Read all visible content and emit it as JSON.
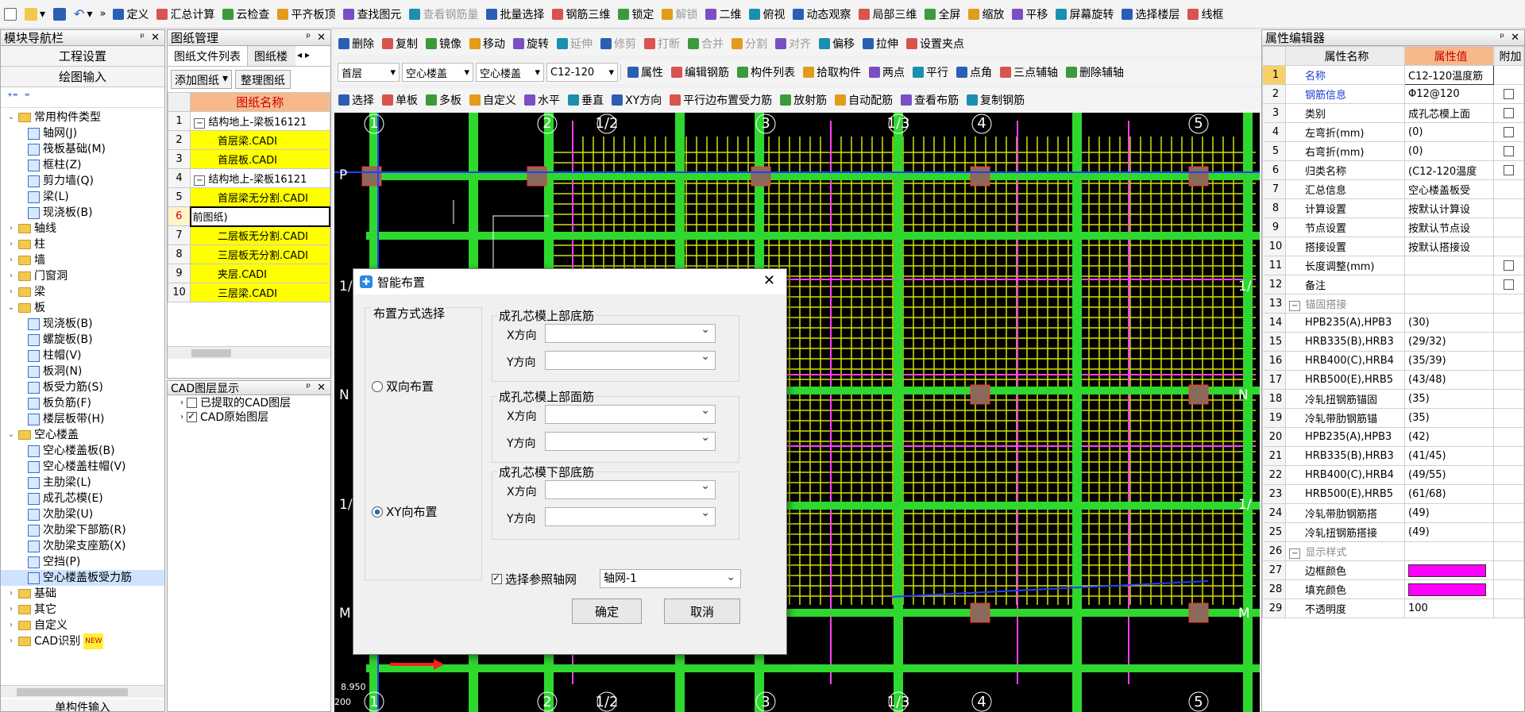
{
  "toolbar1": {
    "items": [
      "定义",
      "汇总计算",
      "云检查",
      "平齐板顶",
      "查找图元",
      "查看钢筋量",
      "批量选择",
      "钢筋三维",
      "锁定",
      "解锁",
      "二维",
      "俯视",
      "动态观察",
      "局部三维",
      "全屏",
      "缩放",
      "平移",
      "屏幕旋转",
      "选择楼层",
      "线框"
    ]
  },
  "toolbar2": {
    "items": [
      "删除",
      "复制",
      "镜像",
      "移动",
      "旋转",
      "延伸",
      "修剪",
      "打断",
      "合并",
      "分割",
      "对齐",
      "偏移",
      "拉伸",
      "设置夹点"
    ]
  },
  "toolbar3": {
    "floor": "首层",
    "cat": "空心楼盖",
    "sub": "空心楼盖",
    "comp": "C12-120",
    "items": [
      "属性",
      "编辑钢筋",
      "构件列表",
      "拾取构件",
      "两点",
      "平行",
      "点角",
      "三点辅轴",
      "删除辅轴"
    ]
  },
  "toolbar4": {
    "items": [
      "选择",
      "单板",
      "多板",
      "自定义",
      "水平",
      "垂直",
      "XY方向",
      "平行边布置受力筋",
      "放射筋",
      "自动配筋",
      "查看布筋",
      "复制钢筋"
    ]
  },
  "nav": {
    "title": "模块导航栏",
    "btn1": "工程设置",
    "btn2": "绘图输入",
    "bottom": "单构件输入",
    "tree": [
      {
        "lvl": 0,
        "exp": "⌄",
        "kind": "folder",
        "label": "常用构件类型"
      },
      {
        "lvl": 1,
        "kind": "comp",
        "label": "轴网(J)"
      },
      {
        "lvl": 1,
        "kind": "comp",
        "label": "筏板基础(M)"
      },
      {
        "lvl": 1,
        "kind": "comp",
        "label": "框柱(Z)"
      },
      {
        "lvl": 1,
        "kind": "comp",
        "label": "剪力墙(Q)"
      },
      {
        "lvl": 1,
        "kind": "comp",
        "label": "梁(L)"
      },
      {
        "lvl": 1,
        "kind": "comp",
        "label": "现浇板(B)"
      },
      {
        "lvl": 0,
        "exp": "›",
        "kind": "folder",
        "label": "轴线"
      },
      {
        "lvl": 0,
        "exp": "›",
        "kind": "folder",
        "label": "柱"
      },
      {
        "lvl": 0,
        "exp": "›",
        "kind": "folder",
        "label": "墙"
      },
      {
        "lvl": 0,
        "exp": "›",
        "kind": "folder",
        "label": "门窗洞"
      },
      {
        "lvl": 0,
        "exp": "›",
        "kind": "folder",
        "label": "梁"
      },
      {
        "lvl": 0,
        "exp": "⌄",
        "kind": "folder",
        "label": "板"
      },
      {
        "lvl": 1,
        "kind": "comp",
        "label": "现浇板(B)"
      },
      {
        "lvl": 1,
        "kind": "comp",
        "label": "螺旋板(B)"
      },
      {
        "lvl": 1,
        "kind": "comp",
        "label": "柱帽(V)"
      },
      {
        "lvl": 1,
        "kind": "comp",
        "label": "板洞(N)"
      },
      {
        "lvl": 1,
        "kind": "comp",
        "label": "板受力筋(S)"
      },
      {
        "lvl": 1,
        "kind": "comp",
        "label": "板负筋(F)"
      },
      {
        "lvl": 1,
        "kind": "comp",
        "label": "楼层板带(H)"
      },
      {
        "lvl": 0,
        "exp": "⌄",
        "kind": "folder",
        "label": "空心楼盖"
      },
      {
        "lvl": 1,
        "kind": "comp",
        "label": "空心楼盖板(B)"
      },
      {
        "lvl": 1,
        "kind": "comp",
        "label": "空心楼盖柱帽(V)"
      },
      {
        "lvl": 1,
        "kind": "comp",
        "label": "主肋梁(L)"
      },
      {
        "lvl": 1,
        "kind": "comp",
        "label": "成孔芯模(E)"
      },
      {
        "lvl": 1,
        "kind": "comp",
        "label": "次肋梁(U)"
      },
      {
        "lvl": 1,
        "kind": "comp",
        "label": "次肋梁下部筋(R)"
      },
      {
        "lvl": 1,
        "kind": "comp",
        "label": "次肋梁支座筋(X)"
      },
      {
        "lvl": 1,
        "kind": "comp",
        "label": "空挡(P)"
      },
      {
        "lvl": 1,
        "kind": "comp",
        "label": "空心楼盖板受力筋",
        "sel": true
      },
      {
        "lvl": 0,
        "exp": "›",
        "kind": "folder",
        "label": "基础"
      },
      {
        "lvl": 0,
        "exp": "›",
        "kind": "folder",
        "label": "其它"
      },
      {
        "lvl": 0,
        "exp": "›",
        "kind": "folder",
        "label": "自定义"
      },
      {
        "lvl": 0,
        "exp": "›",
        "kind": "folder",
        "label": "CAD识别",
        "badge": "NEW"
      }
    ]
  },
  "drawings": {
    "title": "图纸管理",
    "tab1": "图纸文件列表",
    "tab2": "图纸楼层",
    "add": "添加图纸",
    "tidy": "整理图纸",
    "col": "图纸名称",
    "rows": [
      {
        "n": "1",
        "name": "结构地上-梁板16121",
        "grp": true
      },
      {
        "n": "2",
        "name": "首层梁.CADI",
        "y": true
      },
      {
        "n": "3",
        "name": "首层板.CADI",
        "y": true
      },
      {
        "n": "4",
        "name": "结构地上-梁板16121",
        "grp": true
      },
      {
        "n": "5",
        "name": "首层梁无分割.CADI",
        "y": true
      },
      {
        "n": "6",
        "name": "前图纸)",
        "cur": true
      },
      {
        "n": "7",
        "name": "二层板无分割.CADI",
        "y": true
      },
      {
        "n": "8",
        "name": "三层板无分割.CADI",
        "y": true
      },
      {
        "n": "9",
        "name": "夹层.CADI",
        "y": true
      },
      {
        "n": "10",
        "name": "三层梁.CADI",
        "y": true
      }
    ]
  },
  "cad": {
    "title": "CAD图层显示",
    "layers": [
      {
        "label": "已提取的CAD图层",
        "checked": false
      },
      {
        "label": "CAD原始图层",
        "checked": true
      }
    ]
  },
  "dialog": {
    "title": "智能布置",
    "group": "布置方式选择",
    "r1": "双向布置",
    "r2": "XY向布置",
    "g1": "成孔芯模上部底筋",
    "g2": "成孔芯模上部面筋",
    "g3": "成孔芯模下部底筋",
    "x": "X方向",
    "y": "Y方向",
    "ref": "选择参照轴网",
    "axis": "轴网-1",
    "ok": "确定",
    "cancel": "取消"
  },
  "props": {
    "title": "属性编辑器",
    "h1": "属性名称",
    "h2": "属性值",
    "h3": "附加",
    "rows": [
      {
        "n": "1",
        "name": "名称",
        "val": "C12-120温度筋",
        "blue": true,
        "sel": true
      },
      {
        "n": "2",
        "name": "钢筋信息",
        "val": "Φ12@120",
        "blue": true,
        "chk": true
      },
      {
        "n": "3",
        "name": "类别",
        "val": "成孔芯模上面",
        "chk": true
      },
      {
        "n": "4",
        "name": "左弯折(mm)",
        "val": "(0)",
        "chk": true
      },
      {
        "n": "5",
        "name": "右弯折(mm)",
        "val": "(0)",
        "chk": true
      },
      {
        "n": "6",
        "name": "归类名称",
        "val": "(C12-120温度",
        "chk": true
      },
      {
        "n": "7",
        "name": "汇总信息",
        "val": "空心楼盖板受"
      },
      {
        "n": "8",
        "name": "计算设置",
        "val": "按默认计算设"
      },
      {
        "n": "9",
        "name": "节点设置",
        "val": "按默认节点设"
      },
      {
        "n": "10",
        "name": "搭接设置",
        "val": "按默认搭接设"
      },
      {
        "n": "11",
        "name": "长度调整(mm)",
        "val": "",
        "chk": true
      },
      {
        "n": "12",
        "name": "备注",
        "val": "",
        "chk": true
      },
      {
        "n": "13",
        "name": "锚固搭接",
        "val": "",
        "grp": true
      },
      {
        "n": "14",
        "name": "HPB235(A),HPB3",
        "val": "(30)",
        "ind": true
      },
      {
        "n": "15",
        "name": "HRB335(B),HRB3",
        "val": "(29/32)",
        "ind": true
      },
      {
        "n": "16",
        "name": "HRB400(C),HRB4",
        "val": "(35/39)",
        "ind": true
      },
      {
        "n": "17",
        "name": "HRB500(E),HRB5",
        "val": "(43/48)",
        "ind": true
      },
      {
        "n": "18",
        "name": "冷轧扭钢筋锚固",
        "val": "(35)",
        "ind": true
      },
      {
        "n": "19",
        "name": "冷轧带肋钢筋锚",
        "val": "(35)",
        "ind": true
      },
      {
        "n": "20",
        "name": "HPB235(A),HPB3",
        "val": "(42)",
        "ind": true
      },
      {
        "n": "21",
        "name": "HRB335(B),HRB3",
        "val": "(41/45)",
        "ind": true
      },
      {
        "n": "22",
        "name": "HRB400(C),HRB4",
        "val": "(49/55)",
        "ind": true
      },
      {
        "n": "23",
        "name": "HRB500(E),HRB5",
        "val": "(61/68)",
        "ind": true
      },
      {
        "n": "24",
        "name": "冷轧带肋钢筋搭",
        "val": "(49)",
        "ind": true
      },
      {
        "n": "25",
        "name": "冷轧扭钢筋搭接",
        "val": "(49)",
        "ind": true
      },
      {
        "n": "26",
        "name": "显示样式",
        "val": "",
        "grp": true
      },
      {
        "n": "27",
        "name": "边框颜色",
        "val": "",
        "color": "#ff00ff",
        "ind": true
      },
      {
        "n": "28",
        "name": "填充颜色",
        "val": "",
        "color": "#ff00ff",
        "ind": true
      },
      {
        "n": "29",
        "name": "不透明度",
        "val": "100",
        "ind": true
      }
    ]
  },
  "canvas": {
    "axes_top": [
      "1",
      "2",
      "1/2",
      "3",
      "1/3",
      "4",
      "5"
    ],
    "axes_bottom": [
      "1",
      "2",
      "1/2",
      "3",
      "1/3",
      "4",
      "5"
    ],
    "left": [
      "P",
      "1/",
      "N",
      "1/",
      "M"
    ],
    "right": [
      "1/",
      "N",
      "1/",
      "M"
    ],
    "elev": "8.950",
    "scale": "200"
  }
}
